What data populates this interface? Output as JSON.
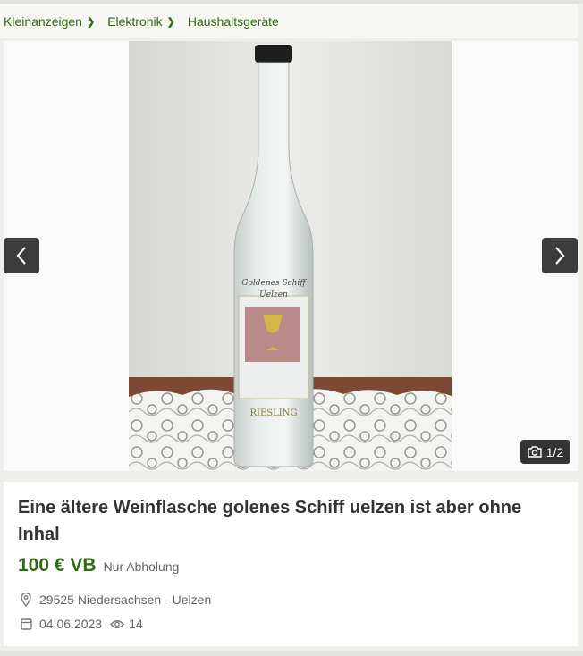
{
  "breadcrumb": {
    "items": [
      {
        "label": "Kleinanzeigen",
        "chevron": true
      },
      {
        "label": "Elektronik",
        "chevron": true
      },
      {
        "label": "Haushaltsgeräte",
        "chevron": false
      }
    ]
  },
  "gallery": {
    "counter": "1/2",
    "prev_icon": "chevron-left-icon",
    "next_icon": "chevron-right-icon",
    "counter_icon": "camera-icon",
    "label_text": {
      "brand": "Goldenes Schiff",
      "city": "Uelzen",
      "variety": "RIESLING"
    }
  },
  "listing": {
    "title": "Eine ältere Weinflasche golenes Schiff uelzen ist aber ohne Inhal",
    "price": "100 € VB",
    "shipping": "Nur Abholung",
    "location": "29525 Niedersachsen - Uelzen",
    "date": "04.06.2023",
    "views": "14"
  },
  "colors": {
    "accent": "#326916",
    "background": "#efefea",
    "card": "#ffffff",
    "text": "#333333",
    "muted": "#666666"
  }
}
